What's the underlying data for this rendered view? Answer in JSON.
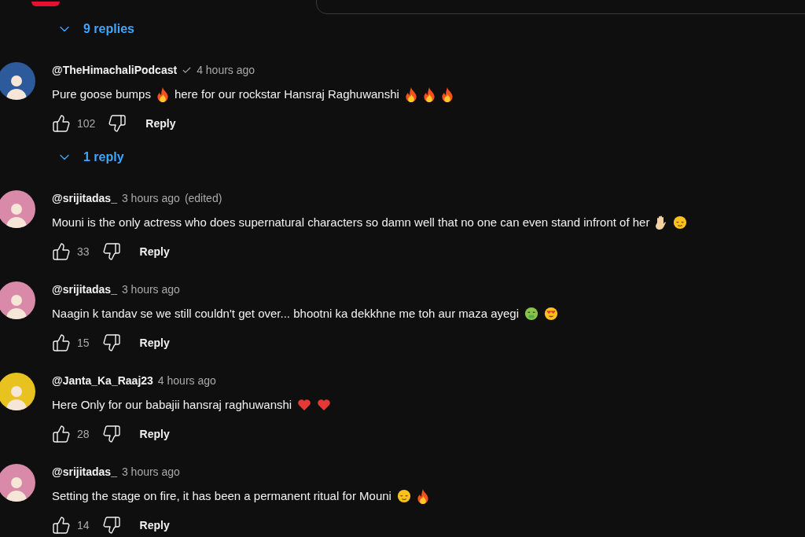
{
  "thread": [
    {
      "kind": "toggle",
      "label": "9 replies"
    },
    {
      "kind": "comment",
      "author": "@TheHimachaliPodcast",
      "verified": true,
      "time": "4 hours ago",
      "likes": "102",
      "reply": "Reply",
      "body": [
        {
          "kind": "text",
          "text": "Pure goose bumps"
        },
        {
          "kind": "fire"
        },
        {
          "kind": "text",
          "text": "here for our rockstar Hansraj Raghuwanshi"
        },
        {
          "kind": "fire"
        },
        {
          "kind": "fire"
        },
        {
          "kind": "fire"
        }
      ]
    },
    {
      "kind": "toggle",
      "label": "1 reply"
    },
    {
      "kind": "comment",
      "author": "@srijitadas_",
      "verified": false,
      "time": "3 hours ago",
      "edited": "(edited)",
      "likes": "33",
      "reply": "Reply",
      "body": [
        {
          "kind": "text",
          "text": "Mouni is the only actress who does supernatural characters so damn well that no one can even stand infront of her"
        },
        {
          "kind": "hand"
        },
        {
          "kind": "relieved"
        }
      ]
    },
    {
      "kind": "comment",
      "author": "@srijitadas_",
      "verified": false,
      "time": "3 hours ago",
      "likes": "15",
      "reply": "Reply",
      "body": [
        {
          "kind": "text",
          "text": "Naagin k tandav se we still couldn't get over... bhootni ka dekkhne me toh aur maza ayegi"
        },
        {
          "kind": "money"
        },
        {
          "kind": "hearteyes"
        }
      ]
    },
    {
      "kind": "comment",
      "author": "@Janta_Ka_Raaj23",
      "verified": false,
      "time": "4 hours ago",
      "likes": "28",
      "reply": "Reply",
      "body": [
        {
          "kind": "text",
          "text": "Here Only for our babajii hansraj raghuwanshi"
        },
        {
          "kind": "heart"
        },
        {
          "kind": "heart"
        }
      ]
    },
    {
      "kind": "comment",
      "author": "@srijitadas_",
      "verified": false,
      "time": "3 hours ago",
      "likes": "14",
      "reply": "Reply",
      "body": [
        {
          "kind": "text",
          "text": "Setting the stage on fire, it has been a permanent ritual for Mouni"
        },
        {
          "kind": "relieved"
        },
        {
          "kind": "fire"
        }
      ]
    }
  ]
}
